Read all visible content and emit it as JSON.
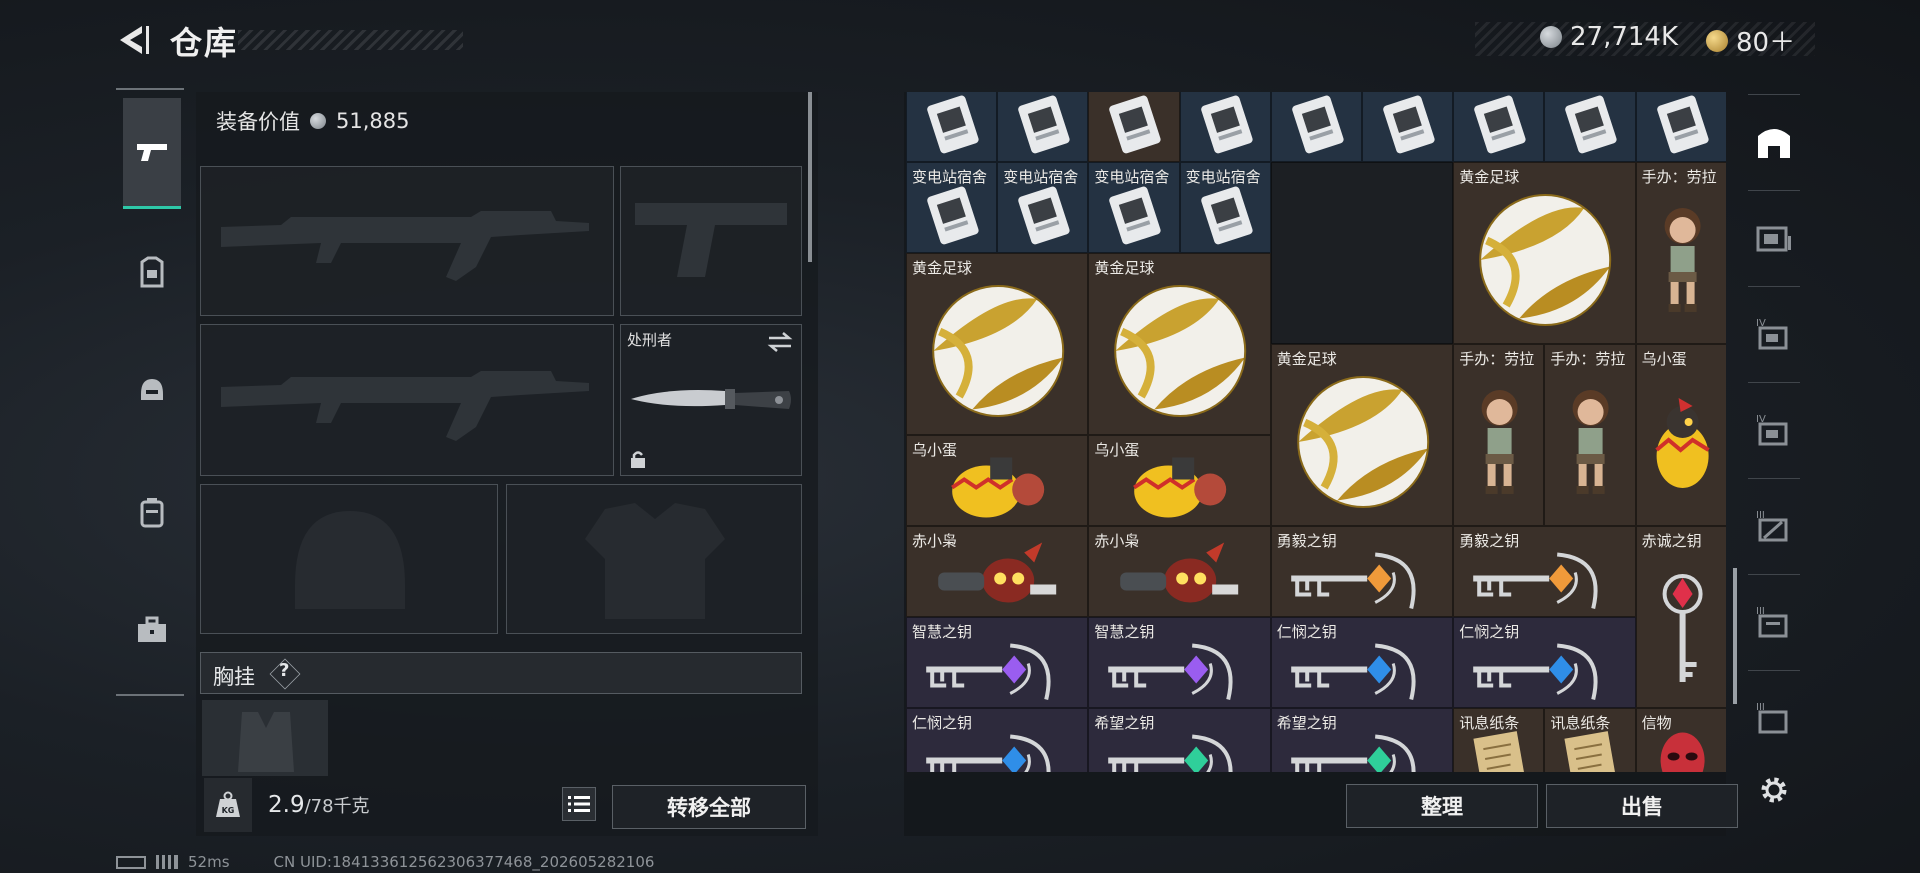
{
  "header": {
    "title": "仓库",
    "currency_silver": "27,714K",
    "currency_gold": "80＋"
  },
  "equipment": {
    "value_label": "装备价值",
    "value": "51,885",
    "melee_name": "处刑者",
    "chest_label": "胸挂",
    "chest_help": "?"
  },
  "weight": {
    "current": "2.9",
    "max": "/78千克",
    "icon_text": "KG"
  },
  "buttons": {
    "transfer_all": "转移全部",
    "sort": "整理",
    "sell": "出售"
  },
  "grid": {
    "items": [
      {
        "label": "",
        "col": 0,
        "row": -1,
        "w": 1,
        "h": 1,
        "bg": "blue",
        "icon": "card"
      },
      {
        "label": "",
        "col": 1,
        "row": -1,
        "w": 1,
        "h": 1,
        "bg": "blue",
        "icon": "card"
      },
      {
        "label": "",
        "col": 2,
        "row": -1,
        "w": 1,
        "h": 1,
        "bg": "brown",
        "icon": "card"
      },
      {
        "label": "",
        "col": 3,
        "row": -1,
        "w": 1,
        "h": 1,
        "bg": "blue",
        "icon": "card"
      },
      {
        "label": "",
        "col": 4,
        "row": -1,
        "w": 1,
        "h": 1,
        "bg": "blue",
        "icon": "card"
      },
      {
        "label": "",
        "col": 5,
        "row": -1,
        "w": 1,
        "h": 1,
        "bg": "blue",
        "icon": "card"
      },
      {
        "label": "",
        "col": 6,
        "row": -1,
        "w": 1,
        "h": 1,
        "bg": "blue",
        "icon": "card"
      },
      {
        "label": "",
        "col": 7,
        "row": -1,
        "w": 1,
        "h": 1,
        "bg": "blue",
        "icon": "card"
      },
      {
        "label": "",
        "col": 8,
        "row": -1,
        "w": 1,
        "h": 1,
        "bg": "blue",
        "icon": "card"
      },
      {
        "label": "变电站宿舍",
        "col": 0,
        "row": 0,
        "w": 1,
        "h": 1,
        "bg": "blue",
        "icon": "card"
      },
      {
        "label": "变电站宿舍",
        "col": 1,
        "row": 0,
        "w": 1,
        "h": 1,
        "bg": "blue",
        "icon": "card"
      },
      {
        "label": "变电站宿舍",
        "col": 2,
        "row": 0,
        "w": 1,
        "h": 1,
        "bg": "blue",
        "icon": "card"
      },
      {
        "label": "变电站宿舍",
        "col": 3,
        "row": 0,
        "w": 1,
        "h": 1,
        "bg": "blue",
        "icon": "card"
      },
      {
        "label": "",
        "col": 4,
        "row": 0,
        "w": 2,
        "h": 2,
        "bg": "empty",
        "icon": "none"
      },
      {
        "label": "黄金足球",
        "col": 6,
        "row": 0,
        "w": 2,
        "h": 2,
        "bg": "brown",
        "icon": "ball"
      },
      {
        "label": "手办：劳拉",
        "col": 8,
        "row": 0,
        "w": 1,
        "h": 2,
        "bg": "brown",
        "icon": "figure"
      },
      {
        "label": "黄金足球",
        "col": 0,
        "row": 1,
        "w": 2,
        "h": 2,
        "bg": "brown",
        "icon": "ball"
      },
      {
        "label": "黄金足球",
        "col": 2,
        "row": 1,
        "w": 2,
        "h": 2,
        "bg": "brown",
        "icon": "ball"
      },
      {
        "label": "黄金足球",
        "col": 4,
        "row": 2,
        "w": 2,
        "h": 2,
        "bg": "brown",
        "icon": "ball"
      },
      {
        "label": "手办：劳拉",
        "col": 6,
        "row": 2,
        "w": 1,
        "h": 2,
        "bg": "brown",
        "icon": "figure"
      },
      {
        "label": "手办：劳拉",
        "col": 7,
        "row": 2,
        "w": 1,
        "h": 2,
        "bg": "brown",
        "icon": "figure"
      },
      {
        "label": "乌小蛋",
        "col": 8,
        "row": 2,
        "w": 1,
        "h": 2,
        "bg": "brown",
        "icon": "egg"
      },
      {
        "label": "乌小蛋",
        "col": 0,
        "row": 3,
        "w": 2,
        "h": 1,
        "bg": "brown",
        "icon": "egg-wide"
      },
      {
        "label": "乌小蛋",
        "col": 2,
        "row": 3,
        "w": 2,
        "h": 1,
        "bg": "brown",
        "icon": "egg-wide"
      },
      {
        "label": "赤小枭",
        "col": 0,
        "row": 4,
        "w": 2,
        "h": 1,
        "bg": "brown",
        "icon": "owl"
      },
      {
        "label": "赤小枭",
        "col": 2,
        "row": 4,
        "w": 2,
        "h": 1,
        "bg": "brown",
        "icon": "owl"
      },
      {
        "label": "勇毅之钥",
        "col": 4,
        "row": 4,
        "w": 2,
        "h": 1,
        "bg": "brown",
        "icon": "key-orange"
      },
      {
        "label": "勇毅之钥",
        "col": 6,
        "row": 4,
        "w": 2,
        "h": 1,
        "bg": "brown",
        "icon": "key-orange"
      },
      {
        "label": "赤诚之钥",
        "col": 8,
        "row": 4,
        "w": 1,
        "h": 2,
        "bg": "brown",
        "icon": "key-red-vertical"
      },
      {
        "label": "智慧之钥",
        "col": 0,
        "row": 5,
        "w": 2,
        "h": 1,
        "bg": "purple",
        "icon": "key-purple"
      },
      {
        "label": "智慧之钥",
        "col": 2,
        "row": 5,
        "w": 2,
        "h": 1,
        "bg": "purple",
        "icon": "key-purple"
      },
      {
        "label": "仁悯之钥",
        "col": 4,
        "row": 5,
        "w": 2,
        "h": 1,
        "bg": "purple",
        "icon": "key-blue"
      },
      {
        "label": "仁悯之钥",
        "col": 6,
        "row": 5,
        "w": 2,
        "h": 1,
        "bg": "purple",
        "icon": "key-blue"
      },
      {
        "label": "仁悯之钥",
        "col": 0,
        "row": 6,
        "w": 2,
        "h": 1,
        "bg": "purple",
        "icon": "key-blue"
      },
      {
        "label": "希望之钥",
        "col": 2,
        "row": 6,
        "w": 2,
        "h": 1,
        "bg": "purple",
        "icon": "key-green"
      },
      {
        "label": "希望之钥",
        "col": 4,
        "row": 6,
        "w": 2,
        "h": 1,
        "bg": "purple",
        "icon": "key-green"
      },
      {
        "label": "讯息纸条",
        "col": 6,
        "row": 6,
        "w": 1,
        "h": 1,
        "bg": "brown",
        "icon": "paper"
      },
      {
        "label": "讯息纸条",
        "col": 7,
        "row": 6,
        "w": 1,
        "h": 1,
        "bg": "brown",
        "icon": "paper"
      },
      {
        "label": "信物",
        "col": 8,
        "row": 6,
        "w": 1,
        "h": 1,
        "bg": "brown",
        "icon": "mask"
      }
    ]
  },
  "footer": {
    "ping": "52ms",
    "uid": "CN UID:18413361256230637746​8_202605282106"
  },
  "colors": {
    "accent": "#2ec8a8",
    "rare_gold_bg": "#3a3029",
    "epic_purple_bg": "#2d2a3c",
    "rare_blue_bg": "#243242"
  }
}
